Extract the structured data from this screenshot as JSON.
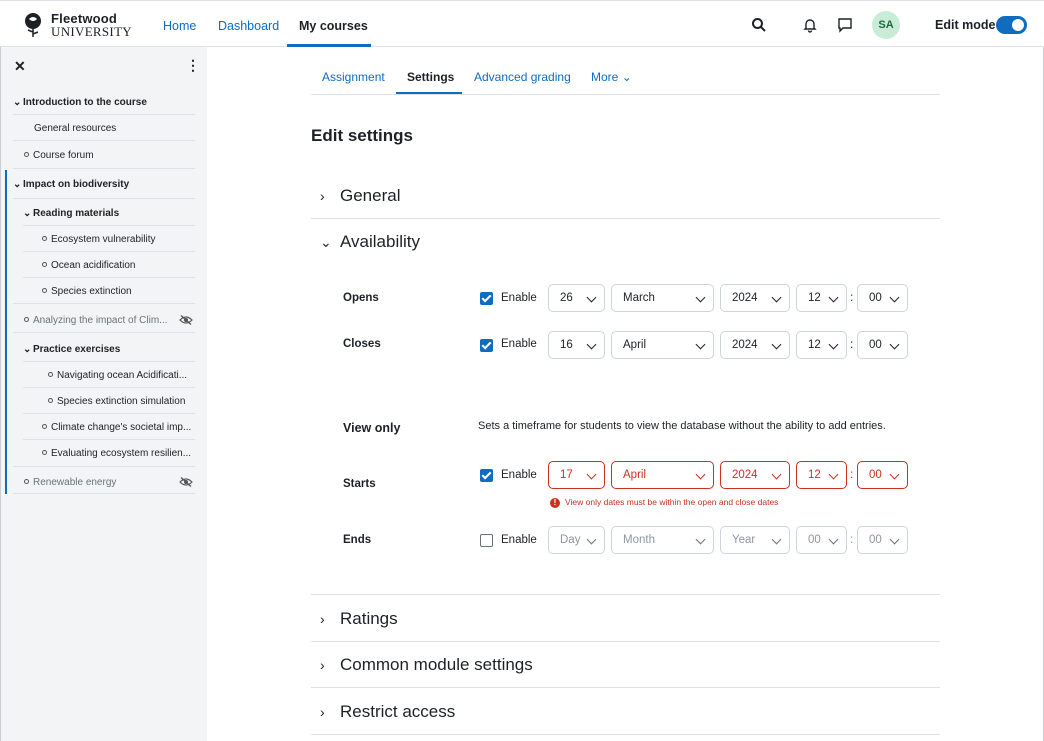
{
  "brand": {
    "name_line1": "Fleetwood",
    "name_line2": "UNIVERSITY"
  },
  "nav": {
    "home": "Home",
    "dashboard": "Dashboard",
    "my_courses": "My courses"
  },
  "user": {
    "initials": "SA"
  },
  "edit_mode": {
    "label": "Edit mode",
    "on": true
  },
  "sidebar": {
    "items": [
      {
        "label": "Introduction to the course"
      },
      {
        "label": "General resources"
      },
      {
        "label": "Course forum"
      },
      {
        "label": "Impact on biodiversity"
      },
      {
        "label": "Reading materials"
      },
      {
        "label": "Ecosystem vulnerability"
      },
      {
        "label": "Ocean acidification"
      },
      {
        "label": "Species extinction"
      },
      {
        "label": "Analyzing the impact of Clim..."
      },
      {
        "label": "Practice exercises"
      },
      {
        "label": "Navigating ocean Acidificati..."
      },
      {
        "label": "Species extinction simulation"
      },
      {
        "label": "Climate change's societal imp..."
      },
      {
        "label": "Evaluating ecosystem resilien..."
      },
      {
        "label": "Renewable energy"
      }
    ]
  },
  "tabs": {
    "assignment": "Assignment",
    "settings": "Settings",
    "advanced_grading": "Advanced grading",
    "more": "More"
  },
  "page_title": "Edit settings",
  "sections": {
    "general": "General",
    "availability": "Availability",
    "ratings": "Ratings",
    "common": "Common module settings",
    "restrict": "Restrict access"
  },
  "availability": {
    "enable_label": "Enable",
    "opens": {
      "label": "Opens",
      "enabled": true,
      "day": "26",
      "month": "March",
      "year": "2024",
      "hour": "12",
      "minute": "00"
    },
    "closes": {
      "label": "Closes",
      "enabled": true,
      "day": "16",
      "month": "April",
      "year": "2024",
      "hour": "12",
      "minute": "00"
    },
    "view_only": {
      "label": "View only",
      "description": "Sets a timeframe for students to view the database without the ability to add entries."
    },
    "starts": {
      "label": "Starts",
      "enabled": true,
      "day": "17",
      "month": "April",
      "year": "2024",
      "hour": "12",
      "minute": "00",
      "error": "View only dates must be within the open and close dates"
    },
    "ends": {
      "label": "Ends",
      "enabled": false,
      "day": "Day",
      "month": "Month",
      "year": "Year",
      "hour": "00",
      "minute": "00"
    }
  },
  "colors": {
    "accent": "#0f6cbf",
    "error": "#ca3120"
  }
}
